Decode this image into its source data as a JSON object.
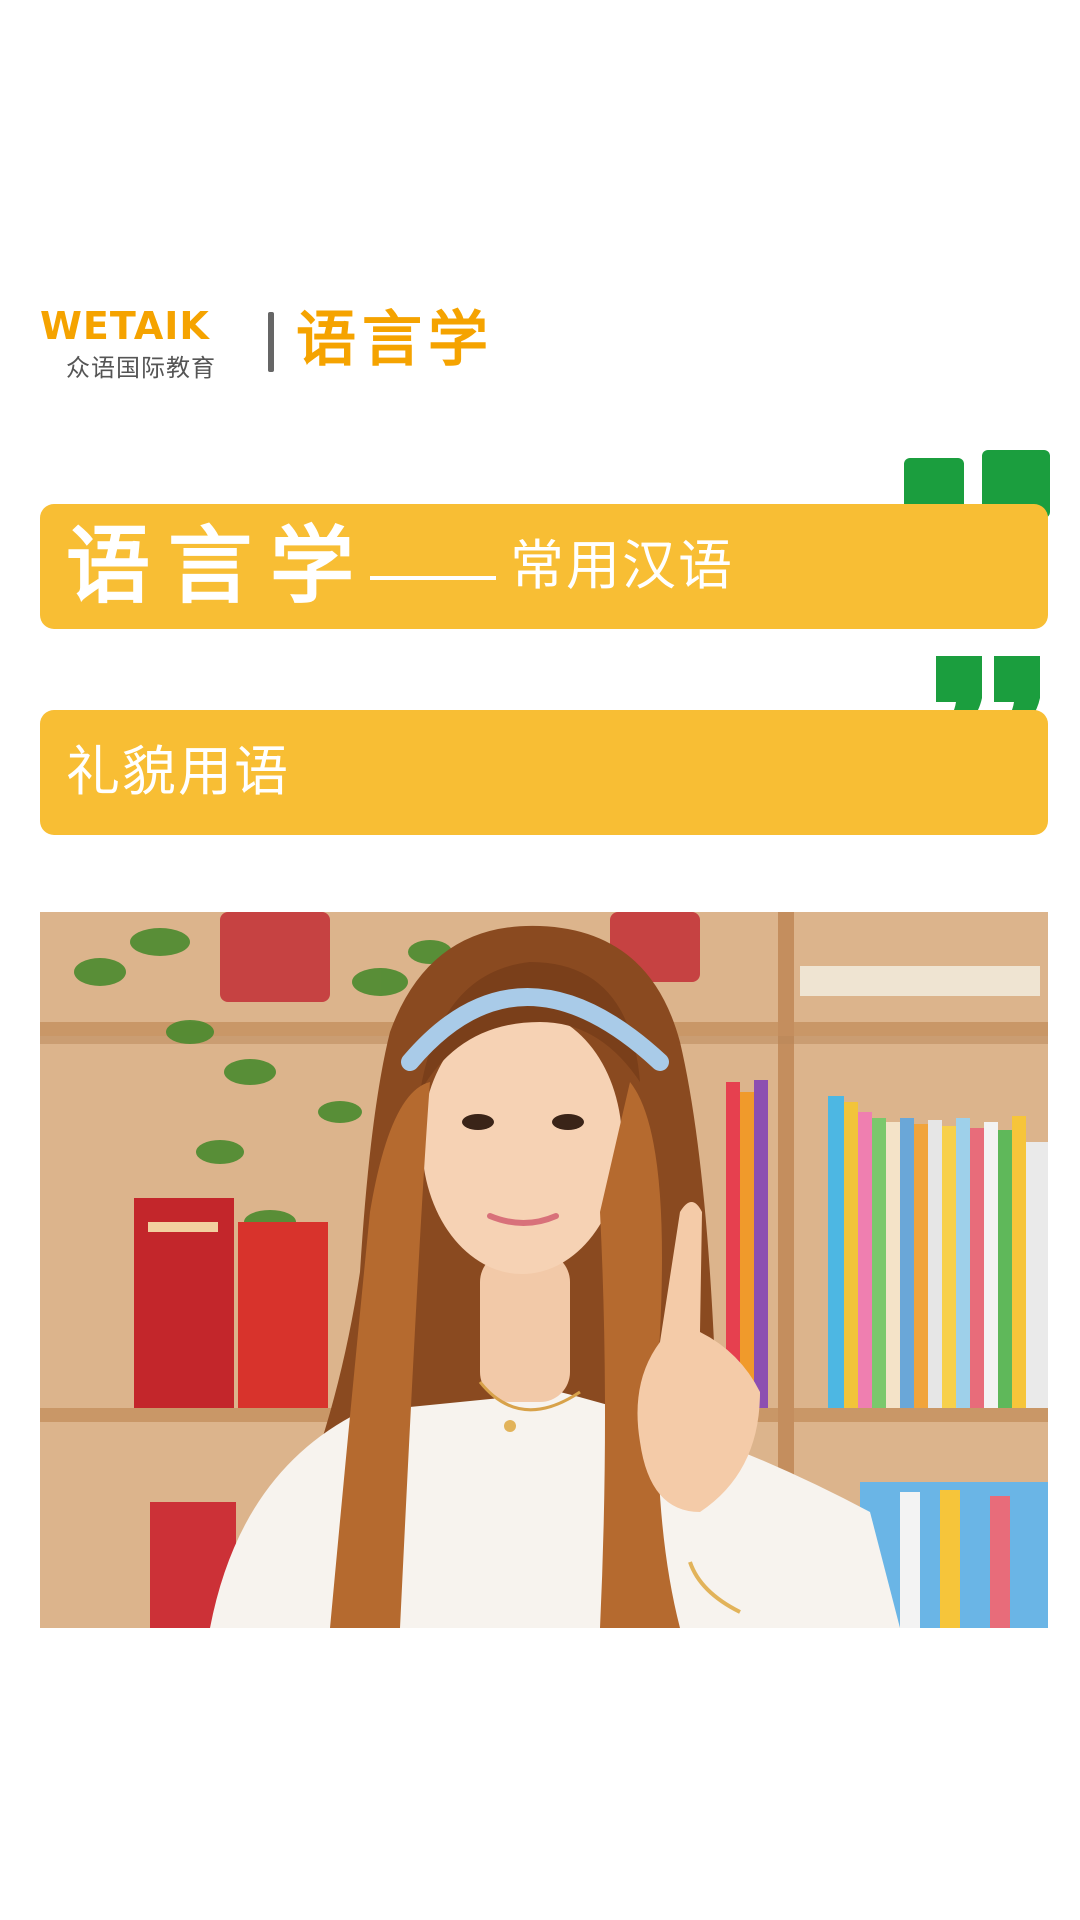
{
  "header": {
    "logo_word": "WETAIK",
    "logo_subtitle": "众语国际教育",
    "brand": "语言学"
  },
  "banner1": {
    "title": "语言学",
    "subtitle": "常用汉语"
  },
  "banner2": {
    "text": "礼貌用语"
  },
  "colors": {
    "banner": "#f8be34",
    "quote_green": "#1b9e3e",
    "brand_orange": "#f5a300",
    "logo_green": "#8dc21f"
  },
  "photo": {
    "icon": "person-photo"
  }
}
